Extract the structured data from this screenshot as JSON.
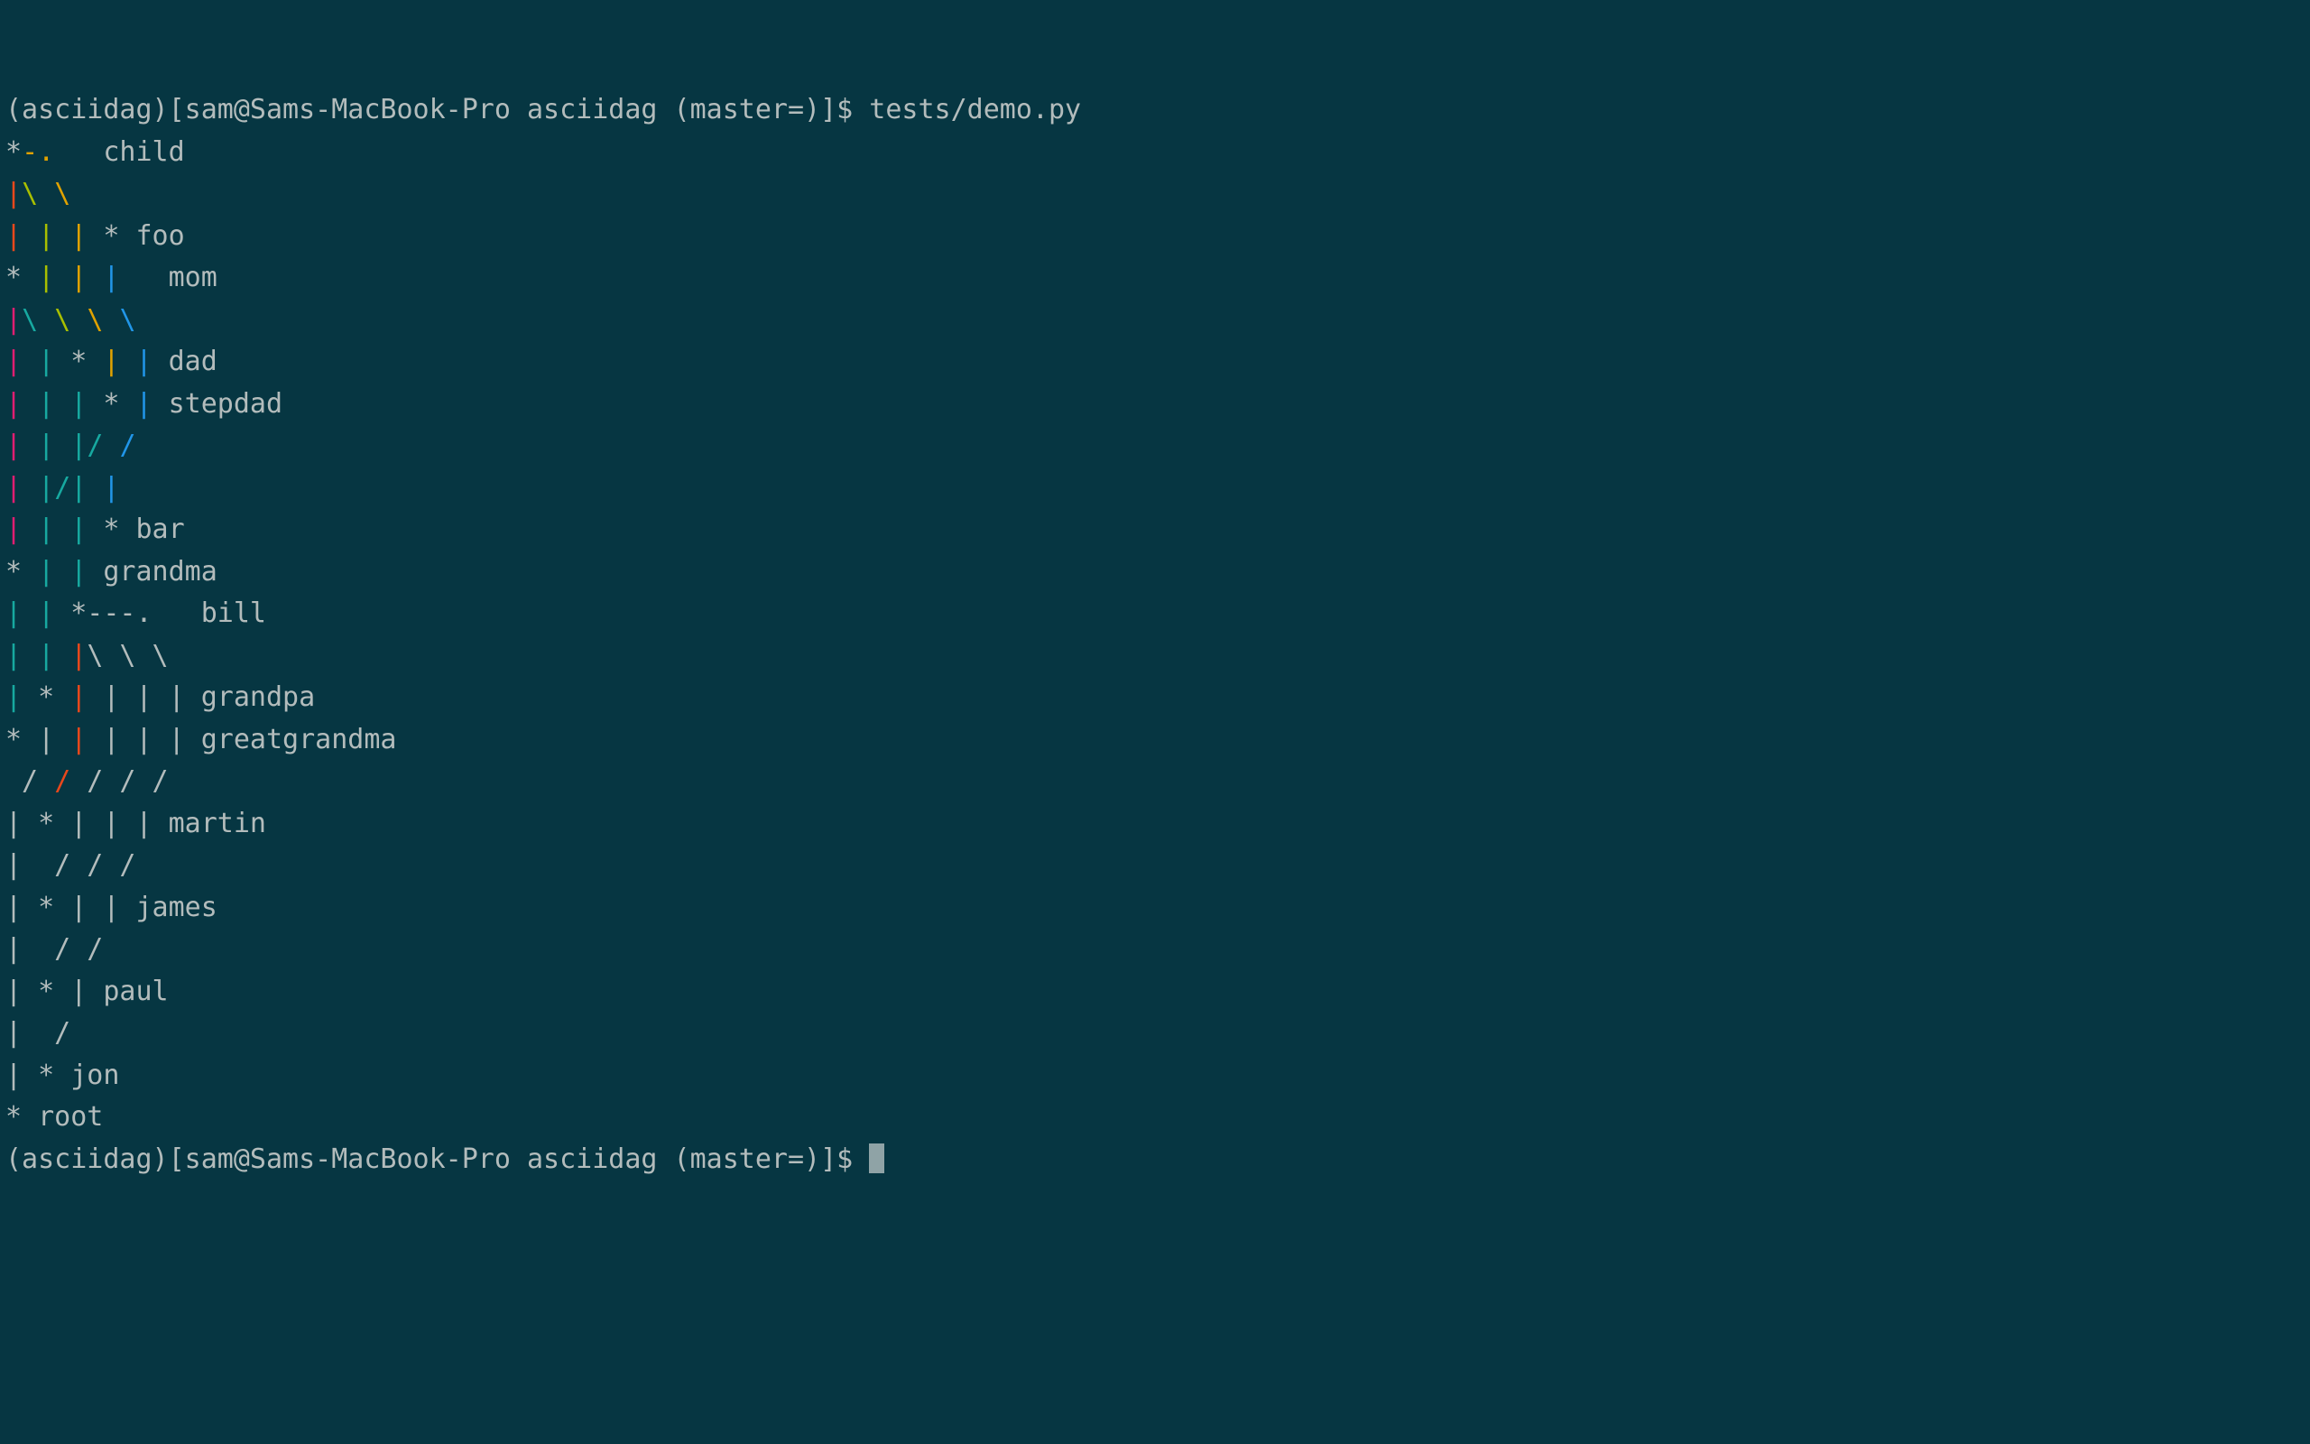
{
  "terminal": {
    "background_color": "#063642",
    "default_fg_color": "#b3bcbc",
    "palette": {
      "red": "#e8481c",
      "green": "#a8bf00",
      "yellow": "#e0a200",
      "blue": "#2196e8",
      "magenta": "#e01e71",
      "cyan": "#17a9a0",
      "gray": "#b3bcbc"
    },
    "prompt": "(asciidag)[sam@Sams-MacBook-Pro asciidag (master=)]$",
    "command": "tests/demo.py",
    "cursor_visible": true
  },
  "lines": [
    {
      "id": "prompt-line-top",
      "spans": [
        {
          "text": "(asciidag)[sam@Sams-MacBook-Pro asciidag (master=)]$ tests/demo.py",
          "color": "default"
        }
      ]
    },
    {
      "id": "row-child",
      "spans": [
        {
          "text": "*",
          "color": "default"
        },
        {
          "text": "-.",
          "color": "yellow"
        },
        {
          "text": "   child",
          "color": "default"
        }
      ]
    },
    {
      "id": "row-edge-1",
      "spans": [
        {
          "text": "|",
          "color": "red"
        },
        {
          "text": "\\",
          "color": "green"
        },
        {
          "text": " ",
          "color": "default"
        },
        {
          "text": "\\",
          "color": "yellow"
        }
      ]
    },
    {
      "id": "row-foo",
      "spans": [
        {
          "text": "|",
          "color": "red"
        },
        {
          "text": " ",
          "color": "default"
        },
        {
          "text": "|",
          "color": "green"
        },
        {
          "text": " ",
          "color": "default"
        },
        {
          "text": "|",
          "color": "yellow"
        },
        {
          "text": " * foo",
          "color": "default"
        }
      ]
    },
    {
      "id": "row-mom",
      "spans": [
        {
          "text": "* ",
          "color": "default"
        },
        {
          "text": "|",
          "color": "green"
        },
        {
          "text": " ",
          "color": "default"
        },
        {
          "text": "|",
          "color": "yellow"
        },
        {
          "text": " ",
          "color": "default"
        },
        {
          "text": "|",
          "color": "blue"
        },
        {
          "text": "   mom",
          "color": "default"
        }
      ]
    },
    {
      "id": "row-edge-2",
      "spans": [
        {
          "text": "|",
          "color": "magenta"
        },
        {
          "text": "\\",
          "color": "cyan"
        },
        {
          "text": " ",
          "color": "default"
        },
        {
          "text": "\\",
          "color": "green"
        },
        {
          "text": " ",
          "color": "default"
        },
        {
          "text": "\\",
          "color": "yellow"
        },
        {
          "text": " ",
          "color": "default"
        },
        {
          "text": "\\",
          "color": "blue"
        }
      ]
    },
    {
      "id": "row-dad",
      "spans": [
        {
          "text": "|",
          "color": "magenta"
        },
        {
          "text": " ",
          "color": "default"
        },
        {
          "text": "|",
          "color": "cyan"
        },
        {
          "text": " * ",
          "color": "default"
        },
        {
          "text": "|",
          "color": "yellow"
        },
        {
          "text": " ",
          "color": "default"
        },
        {
          "text": "|",
          "color": "blue"
        },
        {
          "text": " dad",
          "color": "default"
        }
      ]
    },
    {
      "id": "row-stepdad",
      "spans": [
        {
          "text": "|",
          "color": "magenta"
        },
        {
          "text": " ",
          "color": "default"
        },
        {
          "text": "|",
          "color": "cyan"
        },
        {
          "text": " ",
          "color": "default"
        },
        {
          "text": "|",
          "color": "cyan"
        },
        {
          "text": " * ",
          "color": "default"
        },
        {
          "text": "|",
          "color": "blue"
        },
        {
          "text": " stepdad",
          "color": "default"
        }
      ]
    },
    {
      "id": "row-edge-3",
      "spans": [
        {
          "text": "|",
          "color": "magenta"
        },
        {
          "text": " ",
          "color": "default"
        },
        {
          "text": "|",
          "color": "cyan"
        },
        {
          "text": " ",
          "color": "default"
        },
        {
          "text": "|",
          "color": "cyan"
        },
        {
          "text": "/",
          "color": "cyan"
        },
        {
          "text": " ",
          "color": "default"
        },
        {
          "text": "/",
          "color": "blue"
        }
      ]
    },
    {
      "id": "row-edge-4",
      "spans": [
        {
          "text": "|",
          "color": "magenta"
        },
        {
          "text": " ",
          "color": "default"
        },
        {
          "text": "|",
          "color": "cyan"
        },
        {
          "text": "/",
          "color": "cyan"
        },
        {
          "text": "|",
          "color": "cyan"
        },
        {
          "text": " ",
          "color": "default"
        },
        {
          "text": "|",
          "color": "blue"
        }
      ]
    },
    {
      "id": "row-bar",
      "spans": [
        {
          "text": "|",
          "color": "magenta"
        },
        {
          "text": " ",
          "color": "default"
        },
        {
          "text": "|",
          "color": "cyan"
        },
        {
          "text": " ",
          "color": "default"
        },
        {
          "text": "|",
          "color": "cyan"
        },
        {
          "text": " * bar",
          "color": "default"
        }
      ]
    },
    {
      "id": "row-grandma",
      "spans": [
        {
          "text": "* ",
          "color": "default"
        },
        {
          "text": "|",
          "color": "cyan"
        },
        {
          "text": " ",
          "color": "default"
        },
        {
          "text": "|",
          "color": "cyan"
        },
        {
          "text": " grandma",
          "color": "default"
        }
      ]
    },
    {
      "id": "row-bill",
      "spans": [
        {
          "text": "|",
          "color": "cyan"
        },
        {
          "text": " ",
          "color": "default"
        },
        {
          "text": "|",
          "color": "cyan"
        },
        {
          "text": " *---.   bill",
          "color": "default"
        }
      ]
    },
    {
      "id": "row-edge-5",
      "spans": [
        {
          "text": "|",
          "color": "cyan"
        },
        {
          "text": " ",
          "color": "default"
        },
        {
          "text": "|",
          "color": "cyan"
        },
        {
          "text": " ",
          "color": "default"
        },
        {
          "text": "|",
          "color": "red"
        },
        {
          "text": "\\ \\ \\",
          "color": "default"
        }
      ]
    },
    {
      "id": "row-grandpa",
      "spans": [
        {
          "text": "|",
          "color": "cyan"
        },
        {
          "text": " * ",
          "color": "default"
        },
        {
          "text": "|",
          "color": "red"
        },
        {
          "text": " | | | grandpa",
          "color": "default"
        }
      ]
    },
    {
      "id": "row-greatgrandma",
      "spans": [
        {
          "text": "* | ",
          "color": "default"
        },
        {
          "text": "|",
          "color": "red"
        },
        {
          "text": " | | | greatgrandma",
          "color": "default"
        }
      ]
    },
    {
      "id": "row-edge-6",
      "spans": [
        {
          "text": " / ",
          "color": "default"
        },
        {
          "text": "/",
          "color": "red"
        },
        {
          "text": " / / /",
          "color": "default"
        }
      ]
    },
    {
      "id": "row-martin",
      "spans": [
        {
          "text": "| * | | | martin",
          "color": "default"
        }
      ]
    },
    {
      "id": "row-edge-7",
      "spans": [
        {
          "text": "|  / / /",
          "color": "default"
        }
      ]
    },
    {
      "id": "row-james",
      "spans": [
        {
          "text": "| * | | james",
          "color": "default"
        }
      ]
    },
    {
      "id": "row-edge-8",
      "spans": [
        {
          "text": "|  / /",
          "color": "default"
        }
      ]
    },
    {
      "id": "row-paul",
      "spans": [
        {
          "text": "| * | paul",
          "color": "default"
        }
      ]
    },
    {
      "id": "row-edge-9",
      "spans": [
        {
          "text": "|  /",
          "color": "default"
        }
      ]
    },
    {
      "id": "row-jon",
      "spans": [
        {
          "text": "| * jon",
          "color": "default"
        }
      ]
    },
    {
      "id": "row-root",
      "spans": [
        {
          "text": "* root",
          "color": "default"
        }
      ]
    },
    {
      "id": "prompt-line-bottom",
      "spans": [
        {
          "text": "(asciidag)[sam@Sams-MacBook-Pro asciidag (master=)]$ ",
          "color": "default"
        }
      ],
      "cursor": true
    }
  ],
  "dag": {
    "type": "commit-graph",
    "nodes": [
      "child",
      "foo",
      "mom",
      "dad",
      "stepdad",
      "bar",
      "grandma",
      "bill",
      "grandpa",
      "greatgrandma",
      "martin",
      "james",
      "paul",
      "jon",
      "root"
    ]
  }
}
